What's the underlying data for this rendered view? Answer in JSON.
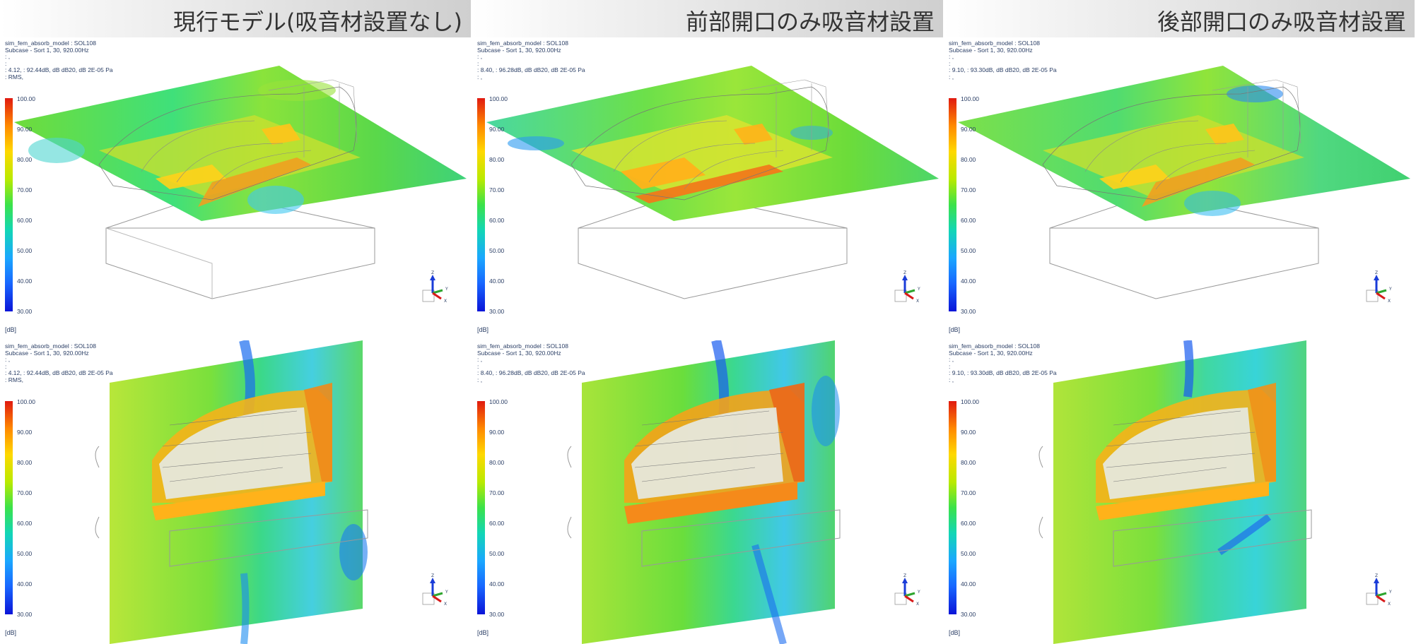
{
  "columns": [
    {
      "title": "現行モデル(吸音材設置なし)",
      "panels": [
        {
          "line1": "sim_fem_absorb_model : SOL108",
          "line2": "Subcase - Sort 1,  30, 920.00Hz",
          "line3": ": ,",
          "line4": ":",
          "line5": ": 4.12,  : 92.44dB, dB dB20, dB 2E-05 Pa",
          "line6": ": RMS,"
        },
        {
          "line1": "sim_fem_absorb_model : SOL108",
          "line2": "Subcase - Sort 1,  30, 920.00Hz",
          "line3": ": ,",
          "line4": ":",
          "line5": ": 4.12,  : 92.44dB, dB dB20, dB 2E-05 Pa",
          "line6": ": RMS,"
        }
      ]
    },
    {
      "title": "前部開口のみ吸音材設置",
      "panels": [
        {
          "line1": "sim_fem_absorb_model : SOL108",
          "line2": "Subcase - Sort 1,  30, 920.00Hz",
          "line3": ": ,",
          "line4": ":",
          "line5": ": 8.40,  : 96.28dB, dB dB20, dB 2E-05 Pa",
          "line6": ": ,"
        },
        {
          "line1": "sim_fem_absorb_model : SOL108",
          "line2": "Subcase - Sort 1,  30, 920.00Hz",
          "line3": ": ,",
          "line4": ":",
          "line5": ": 8.40,  : 96.28dB, dB dB20, dB 2E-05 Pa",
          "line6": ": ,"
        }
      ]
    },
    {
      "title": "後部開口のみ吸音材設置",
      "panels": [
        {
          "line1": "sim_fem_absorb_model : SOL108",
          "line2": "Subcase - Sort 1,  30, 920.00Hz",
          "line3": ": ,",
          "line4": ":",
          "line5": ": 9.10,  : 93.30dB, dB dB20, dB 2E-05 Pa",
          "line6": ": ,"
        },
        {
          "line1": "sim_fem_absorb_model : SOL108",
          "line2": "Subcase - Sort 1,  30, 920.00Hz",
          "line3": ": ,",
          "line4": ":",
          "line5": ": 9.10,  : 93.30dB, dB dB20, dB 2E-05 Pa",
          "line6": ": ,"
        }
      ]
    }
  ],
  "colorbar": {
    "ticks": [
      "100.00",
      "90.00",
      "80.00",
      "70.00",
      "60.00",
      "50.00",
      "40.00",
      "30.00"
    ],
    "unit": "[dB]",
    "colors": [
      "#e01a10",
      "#ff8a00",
      "#ffd800",
      "#b9ea00",
      "#3be24a",
      "#12d6b5",
      "#1aa7ff",
      "#1866ff",
      "#0a14d8"
    ]
  },
  "triad": {
    "z": "Z",
    "y": "Y",
    "x": "X"
  }
}
